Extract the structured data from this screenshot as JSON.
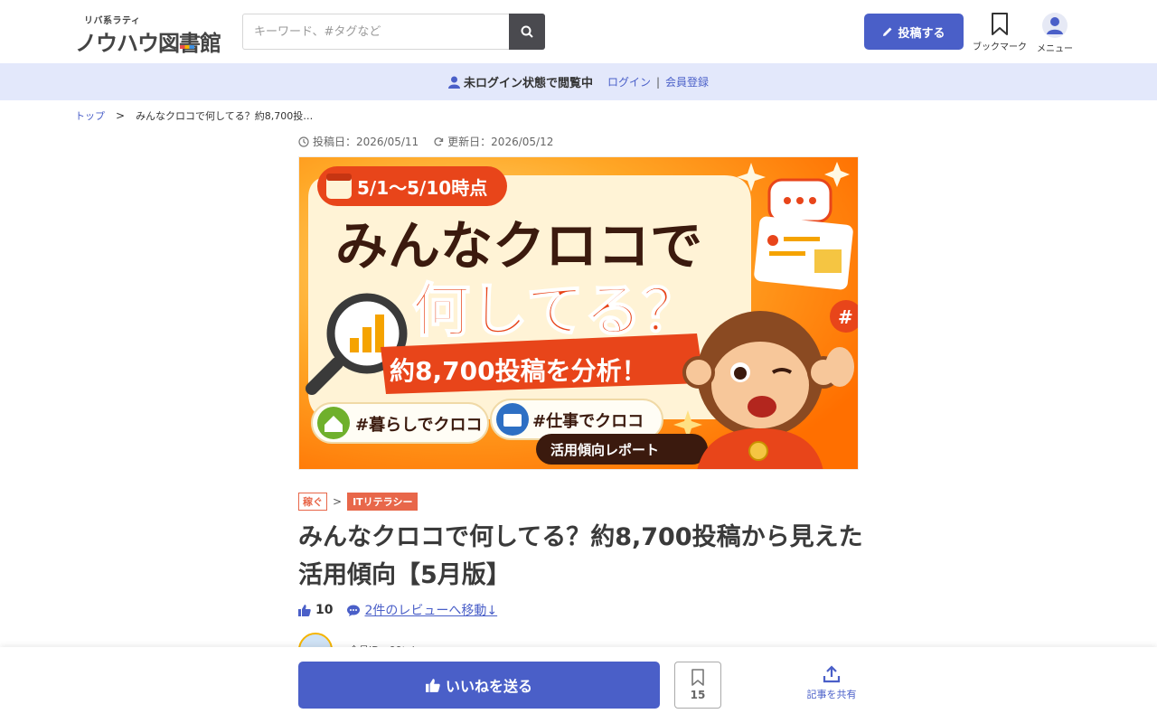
{
  "header": {
    "logo_sub": "リバ系ラティ",
    "logo_main": "ノウハウ図書館",
    "search_placeholder": "キーワード、#タグなど",
    "post_label": "投稿する",
    "bookmark_label": "ブックマーク",
    "menu_label": "メニュー"
  },
  "banner": {
    "status": "未ログイン状態で閲覧中",
    "login": "ログイン",
    "separator": "|",
    "register": "会員登録"
  },
  "breadcrumb": {
    "top": "トップ",
    "arrow": ">",
    "current": "みんなクロコで何してる？約8,700投…"
  },
  "article": {
    "posted_label": "投稿日：2026/05/11",
    "updated_label": "更新日：2026/05/12",
    "hero": {
      "period": "5/1〜5/10時点",
      "headline1": "みんなクロコで",
      "headline2": "何してる？",
      "subline": "約8,700投稿を分析！",
      "tag1": "#暮らしでクロコ",
      "tag2": "#仕事でクロコ",
      "report": "活用傾向レポート"
    },
    "category": "稼ぐ",
    "category_sep": ">",
    "subcategory": "ITリテラシー",
    "title": "みんなクロコで何してる？約8,700投稿から見えた活用傾向【5月版】",
    "likes": "10",
    "review_link": "2件のレビューへ移動↓",
    "author_id": "会員ID：99tah..."
  },
  "bottom_bar": {
    "like_label": "いいねを送る",
    "bookmark_count": "15",
    "share_label": "記事を共有"
  },
  "colors": {
    "accent": "#4a5fc8",
    "banner_bg": "#e3e8fb",
    "tag": "#e8674a",
    "hero_orange": "#ff8f00"
  },
  "icons": [
    "search-icon",
    "pencil-icon",
    "bookmark-icon",
    "user-icon",
    "clock-icon",
    "refresh-icon",
    "thumbs-up-icon",
    "chat-icon",
    "share-icon"
  ]
}
